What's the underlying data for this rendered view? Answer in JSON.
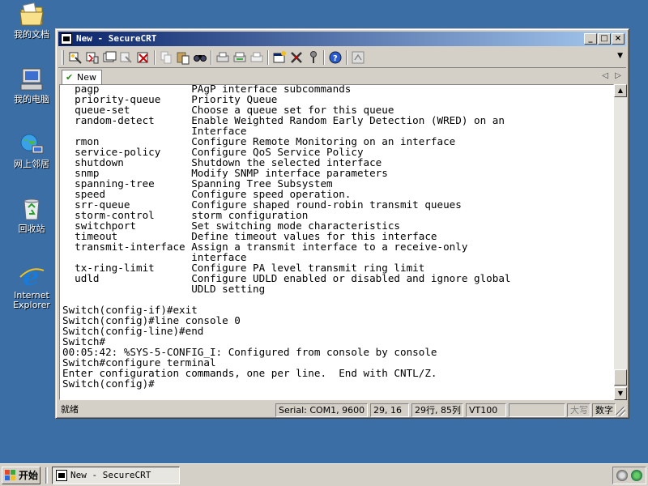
{
  "desktop": {
    "icons": [
      {
        "label": "我的文档",
        "icon": "my-documents-icon"
      },
      {
        "label": "我的电脑",
        "icon": "my-computer-icon"
      },
      {
        "label": "网上邻居",
        "icon": "network-places-icon"
      },
      {
        "label": "回收站",
        "icon": "recycle-bin-icon"
      },
      {
        "label": "Internet Explorer",
        "icon": "internet-explorer-icon"
      }
    ]
  },
  "window": {
    "title": "New - SecureCRT",
    "controls": {
      "minimize": "_",
      "maximize": "□",
      "close": "×"
    }
  },
  "tabs": [
    {
      "label": "New",
      "active": true
    }
  ],
  "tab_nav": {
    "prev": "◁",
    "next": "▷"
  },
  "terminal": {
    "lines": [
      "  pagp               PAgP interface subcommands",
      "  priority-queue     Priority Queue",
      "  queue-set          Choose a queue set for this queue",
      "  random-detect      Enable Weighted Random Early Detection (WRED) on an",
      "                     Interface",
      "  rmon               Configure Remote Monitoring on an interface",
      "  service-policy     Configure QoS Service Policy",
      "  shutdown           Shutdown the selected interface",
      "  snmp               Modify SNMP interface parameters",
      "  spanning-tree      Spanning Tree Subsystem",
      "  speed              Configure speed operation.",
      "  srr-queue          Configure shaped round-robin transmit queues",
      "  storm-control      storm configuration",
      "  switchport         Set switching mode characteristics",
      "  timeout            Define timeout values for this interface",
      "  transmit-interface Assign a transmit interface to a receive-only",
      "                     interface",
      "  tx-ring-limit      Configure PA level transmit ring limit",
      "  udld               Configure UDLD enabled or disabled and ignore global",
      "                     UDLD setting",
      "",
      "Switch(config-if)#exit",
      "Switch(config)#line console 0",
      "Switch(config-line)#end",
      "Switch#",
      "00:05:42: %SYS-5-CONFIG_I: Configured from console by console",
      "Switch#configure terminal",
      "Enter configuration commands, one per line.  End with CNTL/Z.",
      "Switch(config)#"
    ]
  },
  "status": {
    "ready": "就绪",
    "connection": "Serial: COM1, 9600",
    "cursor": "29, 16",
    "size": "29行, 85列",
    "emulation": "VT100",
    "caps": "大写",
    "num": "数字"
  },
  "taskbar": {
    "start": "开始",
    "task": "New - SecureCRT"
  },
  "colors": {
    "desktop": "#3a6ea5",
    "title_start": "#0a246a",
    "title_end": "#a6caf0",
    "face": "#d4d0c8"
  }
}
